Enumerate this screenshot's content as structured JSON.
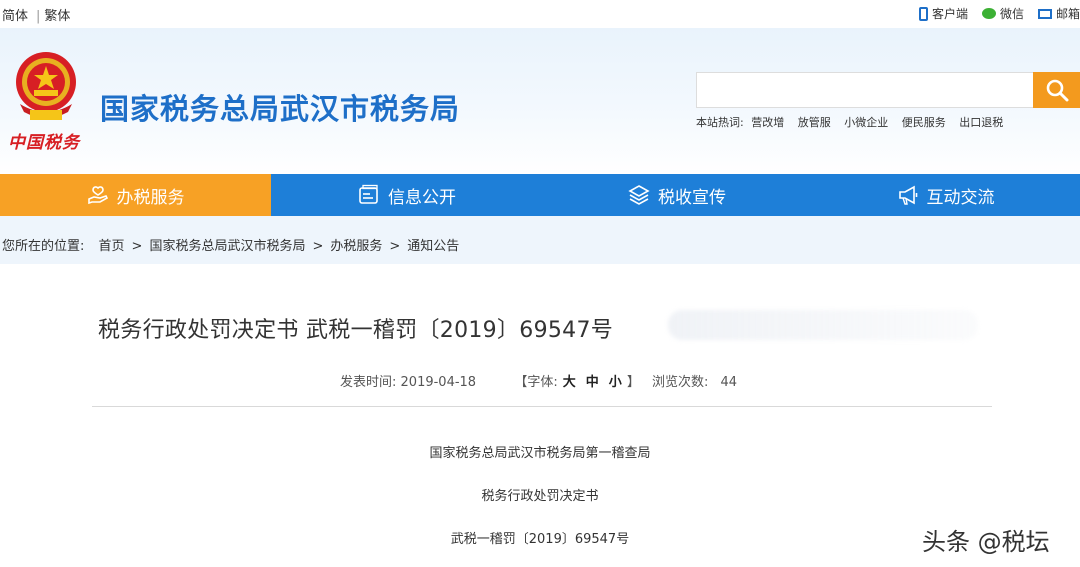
{
  "topbar": {
    "simplified": "简体",
    "traditional": "繁体",
    "client": "客户端",
    "wechat": "微信",
    "mail": "邮箱"
  },
  "header": {
    "brand_script": "中国税务",
    "site_title": "国家税务总局武汉市税务局",
    "search_placeholder": "",
    "hot_label": "本站热词:",
    "hot_words": [
      "营改增",
      "放管服",
      "小微企业",
      "便民服务",
      "出口退税"
    ]
  },
  "nav": {
    "items": [
      {
        "label": "办税服务",
        "icon": "hand-heart-icon",
        "active": true
      },
      {
        "label": "信息公开",
        "icon": "info-card-icon",
        "active": false
      },
      {
        "label": "税收宣传",
        "icon": "layers-icon",
        "active": false
      },
      {
        "label": "互动交流",
        "icon": "megaphone-icon",
        "active": false
      }
    ]
  },
  "breadcrumb": {
    "prefix": "您所在的位置:",
    "items": [
      "首页",
      "国家税务总局武汉市税务局",
      "办税服务",
      "通知公告"
    ],
    "arrow": ">"
  },
  "article": {
    "title": "税务行政处罚决定书 武税一稽罚〔2019〕69547号",
    "publish_label": "发表时间:",
    "publish_date": "2019-04-18",
    "font_label": "【字体:",
    "font_sizes": [
      "大",
      "中",
      "小"
    ],
    "font_close": "】",
    "views_label": "浏览次数:",
    "views": "44",
    "paragraphs": [
      "国家税务总局武汉市税务局第一稽查局",
      "税务行政处罚决定书",
      "武税一稽罚〔2019〕69547号"
    ]
  },
  "watermark": "头条 @税坛",
  "colors": {
    "brand_blue": "#1e7fd8",
    "accent_orange": "#f7a125",
    "title_blue": "#1e6fc8",
    "emblem_red": "#d71f24"
  }
}
